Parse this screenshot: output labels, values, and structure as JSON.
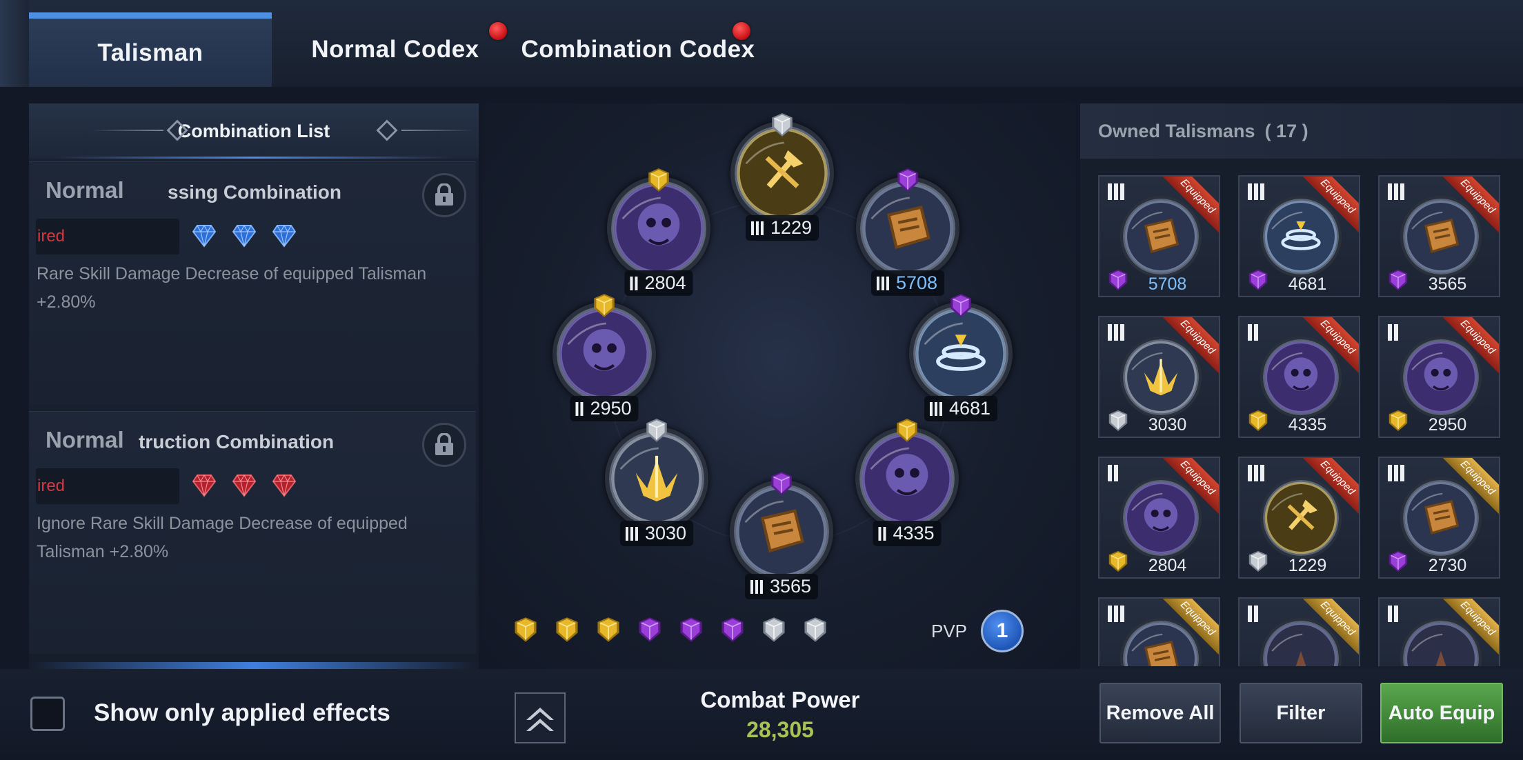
{
  "tabs": [
    {
      "label": "Talisman",
      "active": true,
      "notification": false
    },
    {
      "label": "Normal Codex",
      "active": false,
      "notification": true
    },
    {
      "label": "Combination Codex",
      "active": false,
      "notification": true
    }
  ],
  "combination_list": {
    "title": "Combination List",
    "items": [
      {
        "tier": "Normal",
        "name": "ssing Combination",
        "requirement": "ired",
        "gem_color": "blue",
        "description": "Rare Skill Damage Decrease of equipped Talisman +2.80%",
        "locked": true
      },
      {
        "tier": "Normal",
        "name": "truction Combination",
        "requirement": "ired",
        "gem_color": "red",
        "description": "Ignore Rare Skill Damage Decrease of equipped Talisman +2.80%",
        "locked": true
      }
    ]
  },
  "equipped_slots": [
    {
      "icon": "golden-axe-talisman-icon",
      "gem": "silver",
      "tier": 3,
      "value": "1229",
      "highlight": false
    },
    {
      "icon": "scroll-talisman-icon",
      "gem": "purple",
      "tier": 3,
      "value": "5708",
      "highlight": true
    },
    {
      "icon": "cyclone-talisman-icon",
      "gem": "purple",
      "tier": 3,
      "value": "4681",
      "highlight": false
    },
    {
      "icon": "skull-talisman-icon",
      "gem": "gold",
      "tier": 2,
      "value": "4335",
      "highlight": false
    },
    {
      "icon": "scroll-talisman-icon",
      "gem": "purple",
      "tier": 3,
      "value": "3565",
      "highlight": false
    },
    {
      "icon": "golden-wing-talisman-icon",
      "gem": "silver",
      "tier": 3,
      "value": "3030",
      "highlight": false
    },
    {
      "icon": "skull-talisman-icon",
      "gem": "gold",
      "tier": 2,
      "value": "2950",
      "highlight": false
    },
    {
      "icon": "skull-talisman-icon",
      "gem": "gold",
      "tier": 2,
      "value": "2804",
      "highlight": false
    }
  ],
  "gem_strip": [
    "gold",
    "gold",
    "gold",
    "purple",
    "purple",
    "purple",
    "silver",
    "silver"
  ],
  "pvp": {
    "label": "PVP",
    "value": "1"
  },
  "owned": {
    "title": "Owned Talismans",
    "count": "( 17 )",
    "cards": [
      {
        "icon": "scroll-talisman-icon",
        "tier": 3,
        "gem": "purple",
        "value": "5708",
        "ribbon": "Equipped",
        "ribbon_color": "red",
        "highlight": true
      },
      {
        "icon": "cyclone-talisman-icon",
        "tier": 3,
        "gem": "purple",
        "value": "4681",
        "ribbon": "Equipped",
        "ribbon_color": "red",
        "highlight": false
      },
      {
        "icon": "scroll-talisman-icon",
        "tier": 3,
        "gem": "purple",
        "value": "3565",
        "ribbon": "Equipped",
        "ribbon_color": "red",
        "highlight": false
      },
      {
        "icon": "golden-wing-talisman-icon",
        "tier": 3,
        "gem": "silver",
        "value": "3030",
        "ribbon": "Equipped",
        "ribbon_color": "red",
        "highlight": false
      },
      {
        "icon": "skull-talisman-icon",
        "tier": 2,
        "gem": "gold",
        "value": "4335",
        "ribbon": "Equipped",
        "ribbon_color": "red",
        "highlight": false
      },
      {
        "icon": "skull-talisman-icon",
        "tier": 2,
        "gem": "gold",
        "value": "2950",
        "ribbon": "Equipped",
        "ribbon_color": "red",
        "highlight": false
      },
      {
        "icon": "skull-talisman-icon",
        "tier": 2,
        "gem": "gold",
        "value": "2804",
        "ribbon": "Equipped",
        "ribbon_color": "red",
        "highlight": false
      },
      {
        "icon": "golden-axe-talisman-icon",
        "tier": 3,
        "gem": "silver",
        "value": "1229",
        "ribbon": "Equipped",
        "ribbon_color": "red",
        "highlight": false
      },
      {
        "icon": "scroll-talisman-icon",
        "tier": 3,
        "gem": "purple",
        "value": "2730",
        "ribbon": "Equipped",
        "ribbon_color": "gold",
        "highlight": false
      },
      {
        "icon": "scroll-talisman-icon",
        "tier": 3,
        "gem": "",
        "value": "",
        "ribbon": "Equipped",
        "ribbon_color": "gold",
        "highlight": false
      },
      {
        "icon": "spiked-talisman-icon",
        "tier": 2,
        "gem": "",
        "value": "",
        "ribbon": "Equipped",
        "ribbon_color": "gold",
        "highlight": false
      },
      {
        "icon": "spiked-talisman-icon",
        "tier": 2,
        "gem": "",
        "value": "",
        "ribbon": "Equipped",
        "ribbon_color": "gold",
        "highlight": false
      }
    ]
  },
  "bottom": {
    "checkbox_label": "Show only applied effects",
    "combat_power_label": "Combat Power",
    "combat_power_value": "28,305",
    "buttons": {
      "remove_all": "Remove All",
      "filter": "Filter",
      "auto_equip": "Auto Equip"
    }
  },
  "colors": {
    "accent_blue": "#4f8fe2",
    "highlight_value": "#7cc0ff",
    "combat_power": "#a9c256",
    "requirement_red": "#d63842",
    "gem_gold": "#e7b829",
    "gem_purple": "#9a3fd8",
    "gem_silver": "#c8cdd4",
    "gem_blue": "#2c6fd6",
    "gem_red": "#b5202b"
  }
}
